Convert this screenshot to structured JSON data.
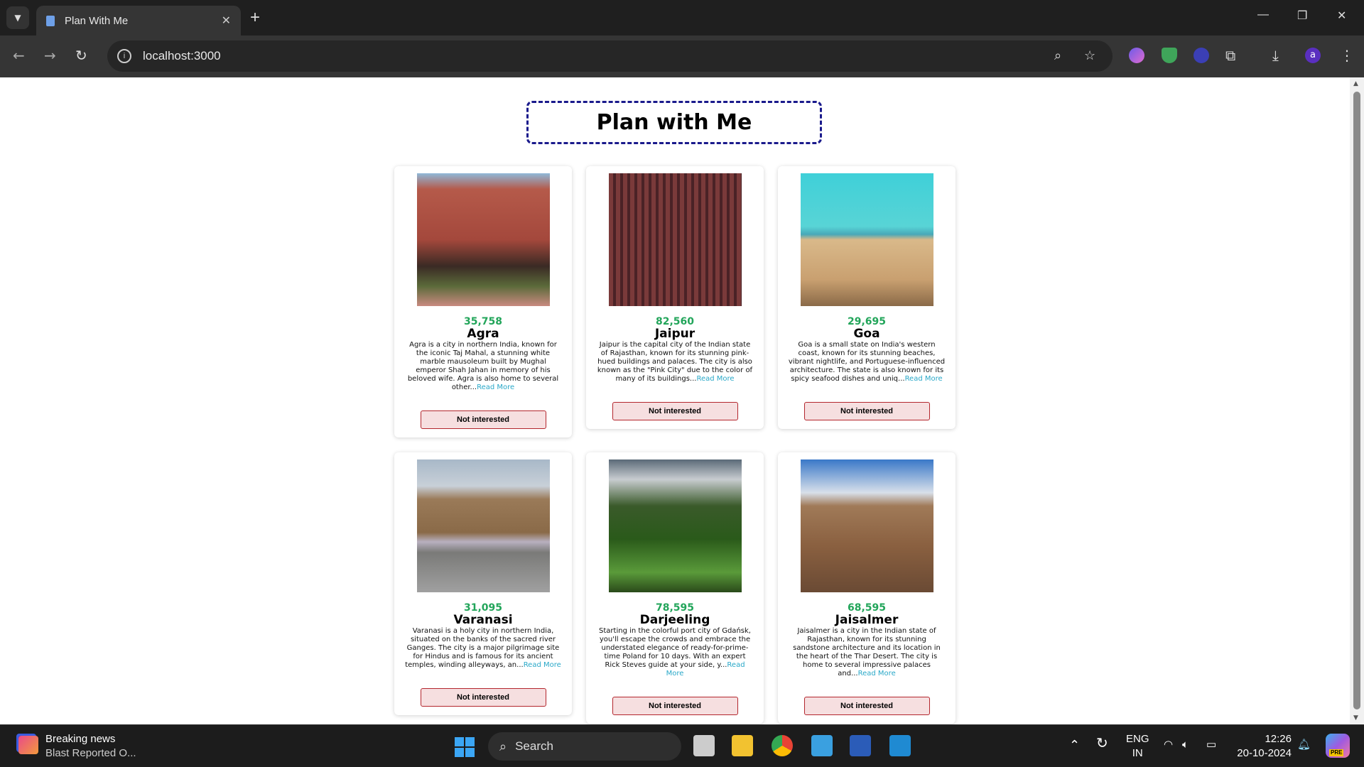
{
  "browser": {
    "tab_title": "Plan With Me",
    "url": "localhost:3000",
    "profile_initial": "a"
  },
  "page": {
    "title": "Plan with Me",
    "read_more_label": "Read More",
    "button_label": "Not interested",
    "price_color": "#22a55a",
    "accent_border": "#1a1a8c"
  },
  "cards": [
    {
      "price": "35,758",
      "city": "Agra",
      "description": "Agra is a city in northern India, known for the iconic Taj Mahal, a stunning white marble mausoleum built by Mughal emperor Shah Jahan in memory of his beloved wife. Agra is also home to several other..."
    },
    {
      "price": "82,560",
      "city": "Jaipur",
      "description": "Jaipur is the capital city of the Indian state of Rajasthan, known for its stunning pink-hued buildings and palaces. The city is also known as the \"Pink City\" due to the color of many of its buildings..."
    },
    {
      "price": "29,695",
      "city": "Goa",
      "description": "Goa is a small state on India's western coast, known for its stunning beaches, vibrant nightlife, and Portuguese-influenced architecture. The state is also known for its spicy seafood dishes and uniq..."
    },
    {
      "price": "31,095",
      "city": "Varanasi",
      "description": "Varanasi is a holy city in northern India, situated on the banks of the sacred river Ganges. The city is a major pilgrimage site for Hindus and is famous for its ancient temples, winding alleyways, an..."
    },
    {
      "price": "78,595",
      "city": "Darjeeling",
      "description": "Starting in the colorful port city of Gdańsk, you'll escape the crowds and embrace the understated elegance of ready-for-prime-time Poland for 10 days. With an expert Rick Steves guide at your side, y..."
    },
    {
      "price": "68,595",
      "city": "Jaisalmer",
      "description": "Jaisalmer is a city in the Indian state of Rajasthan, known for its stunning sandstone architecture and its location in the heart of the Thar Desert. The city is home to several impressive palaces and..."
    }
  ],
  "taskbar": {
    "news_title": "Breaking news",
    "news_sub": "Blast Reported O...",
    "search_label": "Search",
    "lang_line1": "ENG",
    "lang_line2": "IN",
    "time": "12:26",
    "date": "20-10-2024",
    "copilot_badge": "PRE"
  }
}
